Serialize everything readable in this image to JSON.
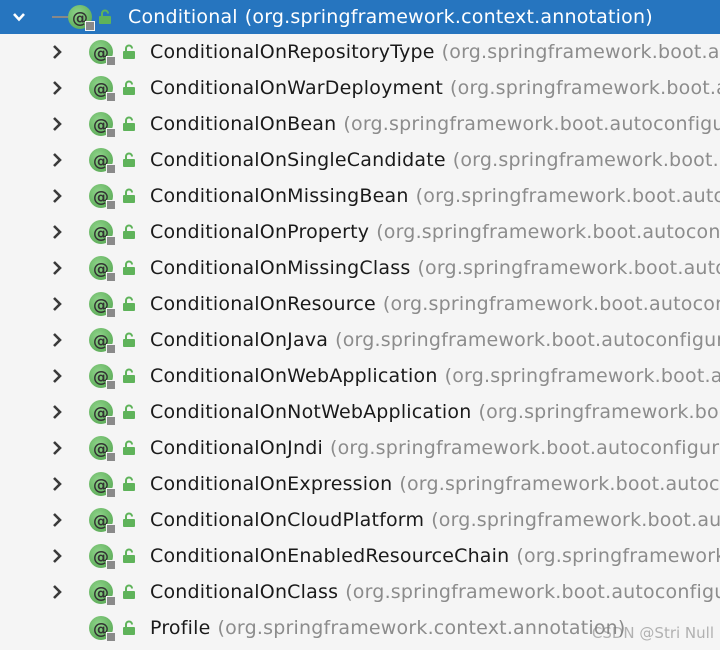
{
  "root": {
    "name": "Conditional",
    "package": "(org.springframework.context.annotation)"
  },
  "children": [
    {
      "name": "ConditionalOnRepositoryType",
      "package": "(org.springframework.boot.au"
    },
    {
      "name": "ConditionalOnWarDeployment",
      "package": "(org.springframework.boot.au"
    },
    {
      "name": "ConditionalOnBean",
      "package": "(org.springframework.boot.autoconfigure"
    },
    {
      "name": "ConditionalOnSingleCandidate",
      "package": "(org.springframework.boot.a"
    },
    {
      "name": "ConditionalOnMissingBean",
      "package": "(org.springframework.boot.autoc"
    },
    {
      "name": "ConditionalOnProperty",
      "package": "(org.springframework.boot.autoconfig"
    },
    {
      "name": "ConditionalOnMissingClass",
      "package": "(org.springframework.boot.autoc"
    },
    {
      "name": "ConditionalOnResource",
      "package": "(org.springframework.boot.autoconf"
    },
    {
      "name": "ConditionalOnJava",
      "package": "(org.springframework.boot.autoconfigure"
    },
    {
      "name": "ConditionalOnWebApplication",
      "package": "(org.springframework.boot.au"
    },
    {
      "name": "ConditionalOnNotWebApplication",
      "package": "(org.springframework.boot"
    },
    {
      "name": "ConditionalOnJndi",
      "package": "(org.springframework.boot.autoconfigure"
    },
    {
      "name": "ConditionalOnExpression",
      "package": "(org.springframework.boot.autoco"
    },
    {
      "name": "ConditionalOnCloudPlatform",
      "package": "(org.springframework.boot.auto"
    },
    {
      "name": "ConditionalOnEnabledResourceChain",
      "package": "(org.springframework"
    },
    {
      "name": "ConditionalOnClass",
      "package": "(org.springframework.boot.autoconfigur"
    },
    {
      "name": "Profile",
      "package": "(org.springframework.context.annotation)"
    }
  ],
  "watermark": "CSDN @Stri Null",
  "icons": {
    "expand": "chevron-right-icon",
    "collapse": "chevron-down-icon",
    "annotation": "annotation-icon",
    "visibility": "public-lock-icon"
  },
  "colors": {
    "selection": "#2675bf",
    "annotation_icon": "#5fb35a",
    "package_text": "#8c8c8c"
  }
}
